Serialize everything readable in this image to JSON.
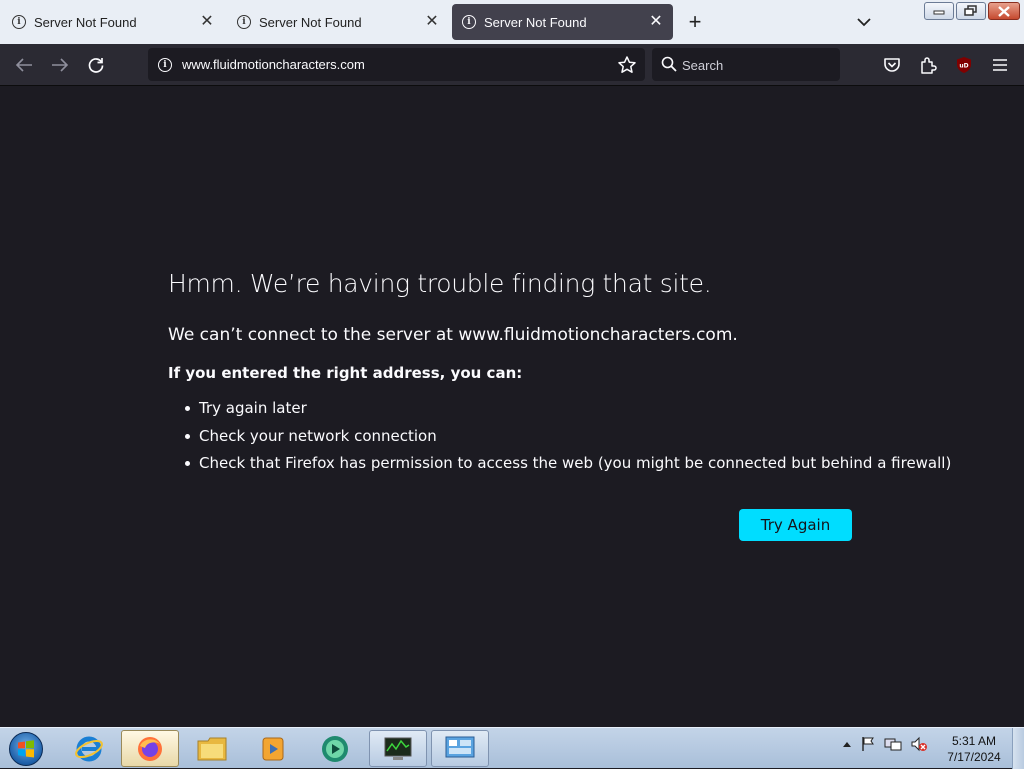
{
  "tabs": [
    {
      "title": "Server Not Found",
      "active": false
    },
    {
      "title": "Server Not Found",
      "active": false
    },
    {
      "title": "Server Not Found",
      "active": true
    }
  ],
  "navbar": {
    "url": "www.fluidmotioncharacters.com",
    "search_placeholder": "Search"
  },
  "error": {
    "title": "Hmm. We’re having trouble finding that site.",
    "description": "We can’t connect to the server at www.fluidmotioncharacters.com.",
    "subtitle": "If you entered the right address, you can:",
    "suggestions": [
      "Try again later",
      "Check your network connection",
      "Check that Firefox has permission to access the web (you might be connected but behind a firewall)"
    ],
    "try_again_label": "Try Again"
  },
  "taskbar": {
    "time": "5:31 AM",
    "date": "7/17/2024"
  },
  "colors": {
    "page_bg": "#1c1b22",
    "accent_button": "#00ddff"
  }
}
